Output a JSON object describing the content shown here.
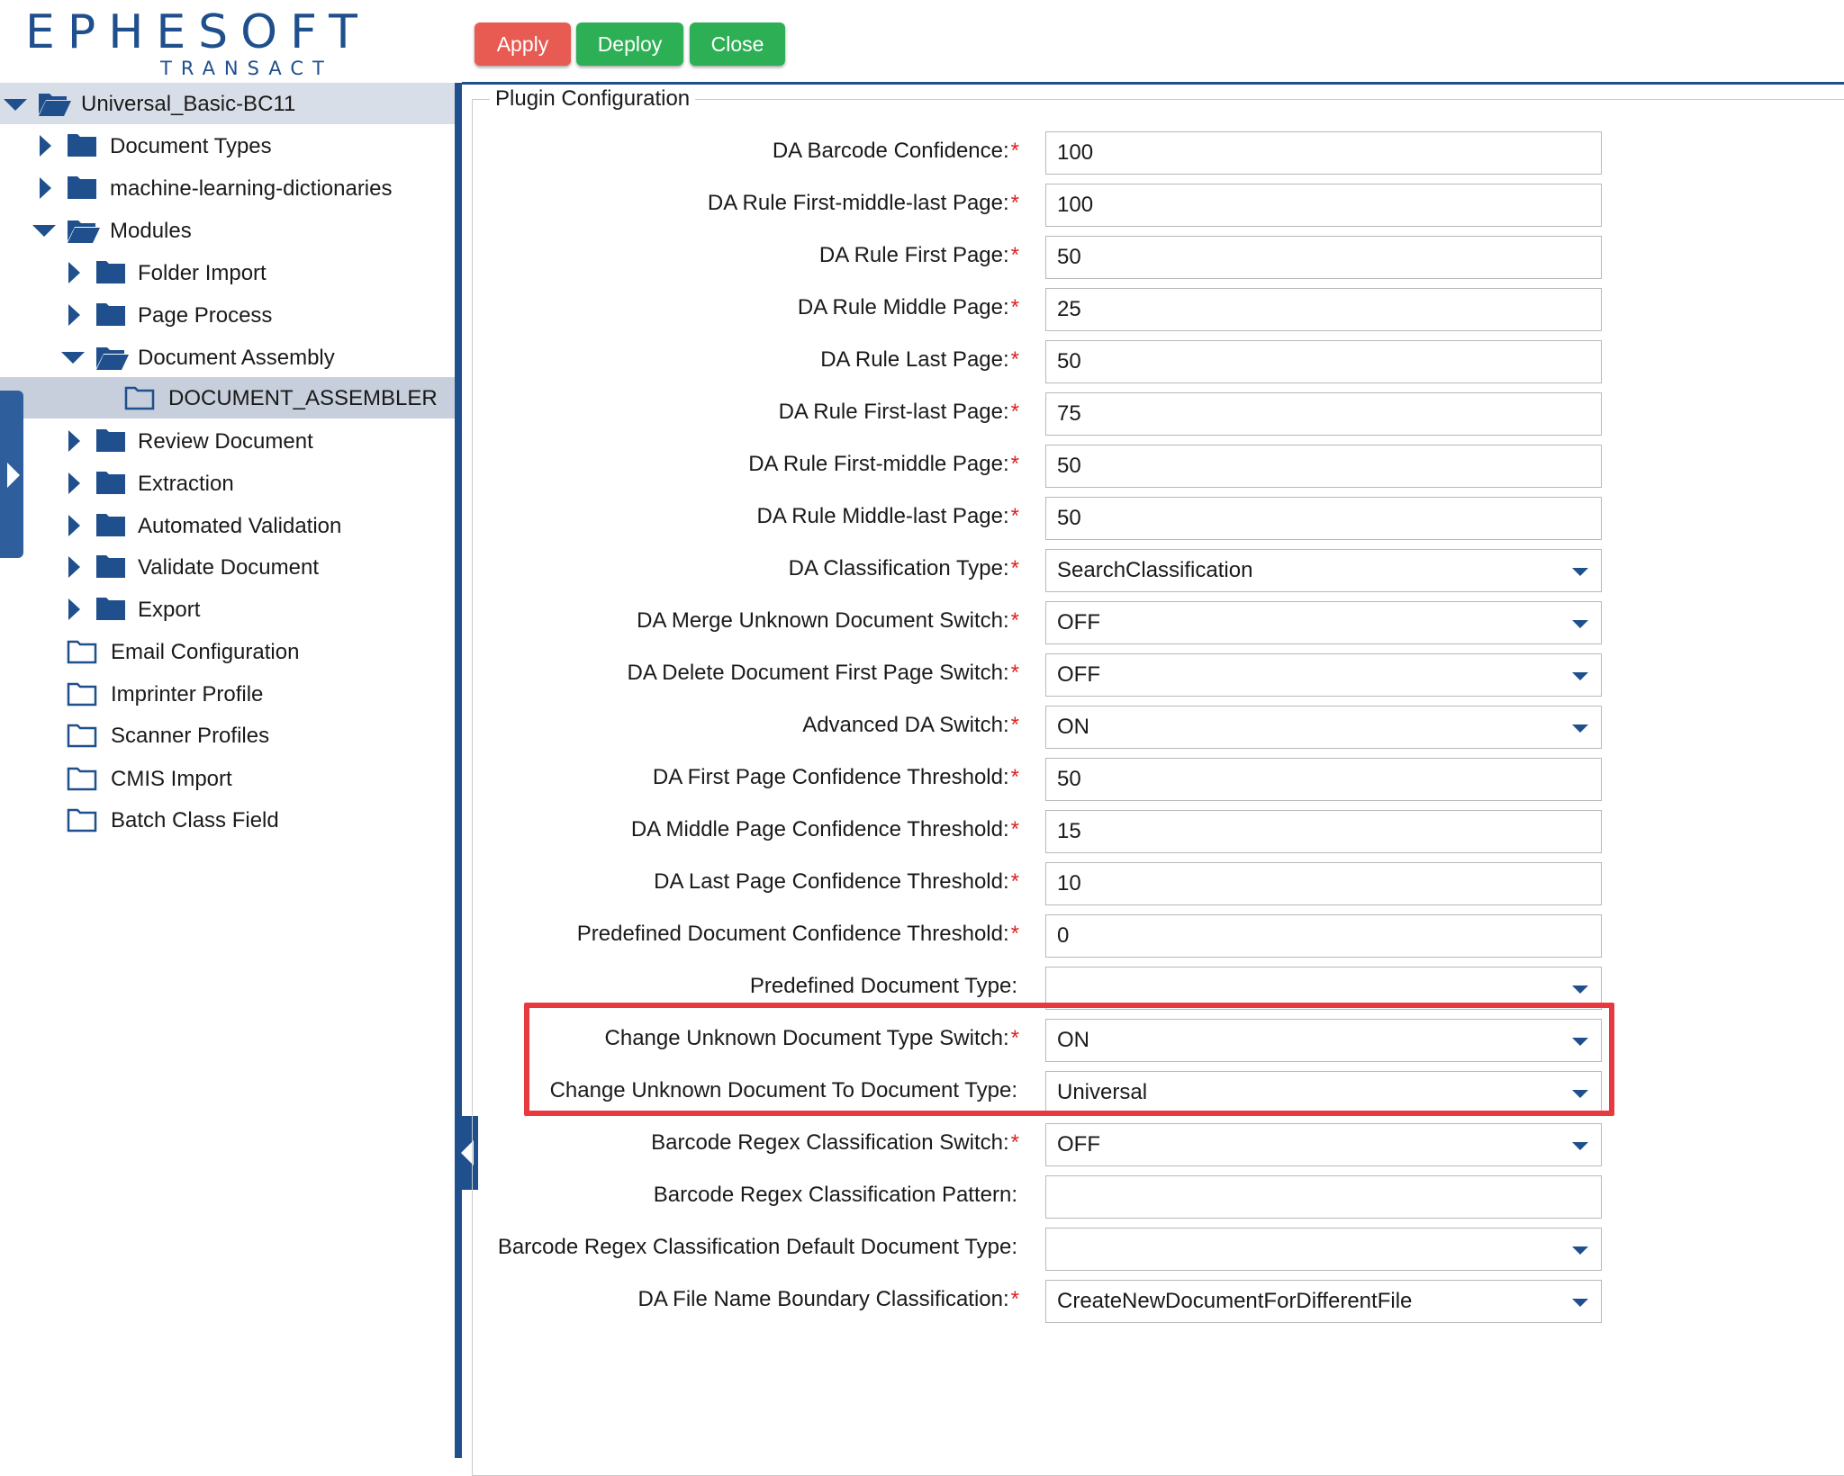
{
  "logo": {
    "main": "EPHESOFT",
    "sub": "TRANSACT"
  },
  "toolbar": {
    "apply": "Apply",
    "deploy": "Deploy",
    "close": "Close"
  },
  "tree": {
    "root": "Universal_Basic-BC11",
    "items": [
      {
        "label": "Document Types"
      },
      {
        "label": "machine-learning-dictionaries"
      },
      {
        "label": "Modules"
      },
      {
        "label": "Folder Import"
      },
      {
        "label": "Page Process"
      },
      {
        "label": "Document Assembly"
      },
      {
        "label": "DOCUMENT_ASSEMBLER"
      },
      {
        "label": "Review Document"
      },
      {
        "label": "Extraction"
      },
      {
        "label": "Automated Validation"
      },
      {
        "label": "Validate Document"
      },
      {
        "label": "Export"
      },
      {
        "label": "Email Configuration"
      },
      {
        "label": "Imprinter Profile"
      },
      {
        "label": "Scanner Profiles"
      },
      {
        "label": "CMIS Import"
      },
      {
        "label": "Batch Class Field"
      }
    ]
  },
  "panel": {
    "legend": "Plugin Configuration",
    "fields": [
      {
        "label": "DA Barcode Confidence:",
        "required": "*",
        "value": "100"
      },
      {
        "label": "DA Rule First-middle-last Page:",
        "required": "*",
        "value": "100"
      },
      {
        "label": "DA Rule First Page:",
        "required": "*",
        "value": "50"
      },
      {
        "label": "DA Rule Middle Page:",
        "required": "*",
        "value": "25"
      },
      {
        "label": "DA Rule Last Page:",
        "required": "*",
        "value": "50"
      },
      {
        "label": "DA Rule First-last Page:",
        "required": "*",
        "value": "75"
      },
      {
        "label": "DA Rule First-middle Page:",
        "required": "*",
        "value": "50"
      },
      {
        "label": "DA Rule Middle-last Page:",
        "required": "*",
        "value": "50"
      },
      {
        "label": "DA Classification Type:",
        "required": "*",
        "value": "SearchClassification"
      },
      {
        "label": "DA Merge Unknown Document Switch:",
        "required": "*",
        "value": "OFF"
      },
      {
        "label": "DA Delete Document First Page Switch:",
        "required": "*",
        "value": "OFF"
      },
      {
        "label": "Advanced DA Switch:",
        "required": "*",
        "value": "ON"
      },
      {
        "label": "DA First Page Confidence Threshold:",
        "required": "*",
        "value": "50"
      },
      {
        "label": "DA Middle Page Confidence Threshold:",
        "required": "*",
        "value": "15"
      },
      {
        "label": "DA Last Page Confidence Threshold:",
        "required": "*",
        "value": "10"
      },
      {
        "label": "Predefined Document Confidence Threshold:",
        "required": "*",
        "value": "0"
      },
      {
        "label": "Predefined Document Type:",
        "required": "",
        "value": ""
      },
      {
        "label": "Change Unknown Document Type Switch:",
        "required": "*",
        "value": "ON"
      },
      {
        "label": "Change Unknown Document To Document Type:",
        "required": "",
        "value": "Universal"
      },
      {
        "label": "Barcode Regex Classification Switch:",
        "required": "*",
        "value": "OFF"
      },
      {
        "label": "Barcode Regex Classification Pattern:",
        "required": "",
        "value": ""
      },
      {
        "label": "Barcode Regex Classification Default Document Type:",
        "required": "",
        "value": ""
      },
      {
        "label": "DA File Name Boundary Classification:",
        "required": "*",
        "value": "CreateNewDocumentForDifferentFile"
      }
    ]
  },
  "colors": {
    "brand": "#1f4f8c",
    "apply": "#e75b52",
    "deploy": "#2db055",
    "highlight": "#e8393f"
  }
}
